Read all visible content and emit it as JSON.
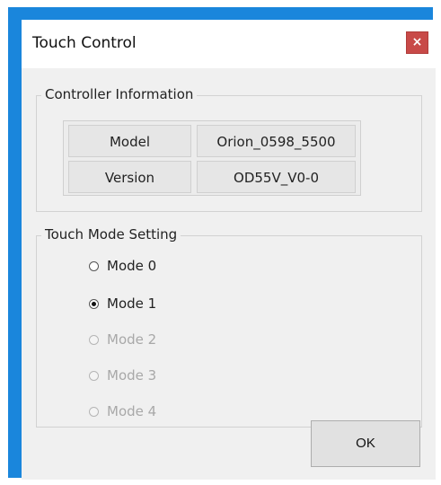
{
  "window": {
    "title": "Touch Control",
    "close_label": "×"
  },
  "controller_info": {
    "group_title": "Controller Information",
    "rows": [
      {
        "label": "Model",
        "value": "Orion_0598_5500"
      },
      {
        "label": "Version",
        "value": "OD55V_V0-0"
      }
    ]
  },
  "touch_mode": {
    "group_title": "Touch Mode Setting",
    "options": [
      {
        "label": "Mode 0",
        "checked": false,
        "enabled": true
      },
      {
        "label": "Mode 1",
        "checked": true,
        "enabled": true
      },
      {
        "label": "Mode 2",
        "checked": false,
        "enabled": false
      },
      {
        "label": "Mode 3",
        "checked": false,
        "enabled": false
      },
      {
        "label": "Mode 4",
        "checked": false,
        "enabled": false
      }
    ]
  },
  "buttons": {
    "ok_label": "OK"
  },
  "colors": {
    "frame_accent": "#1a86dc",
    "close_button": "#c84a48",
    "dialog_background": "#f0f0f0"
  }
}
